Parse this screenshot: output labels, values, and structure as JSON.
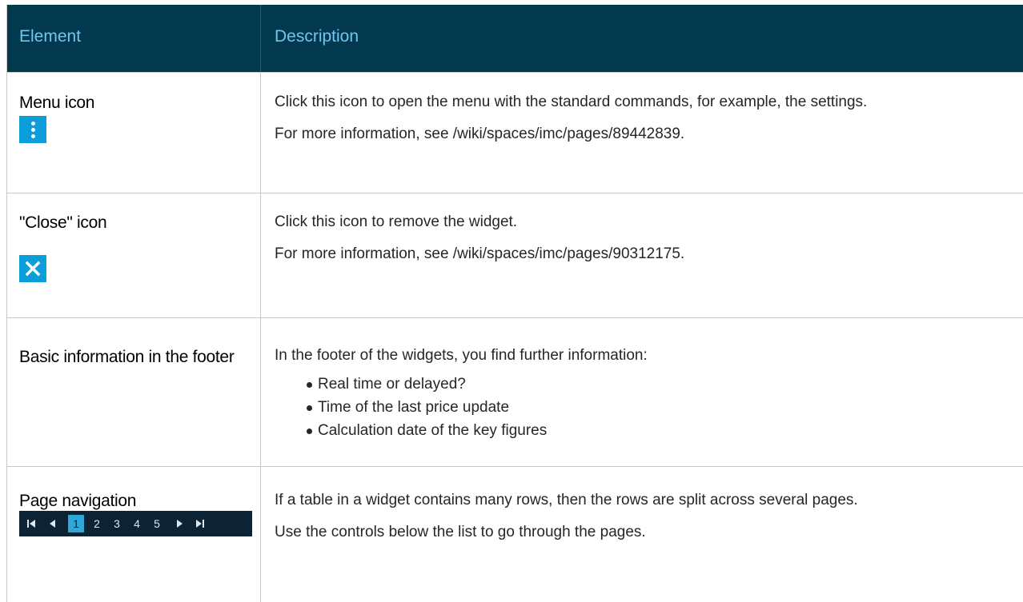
{
  "table": {
    "headers": {
      "element": "Element",
      "description": "Description"
    },
    "rows": [
      {
        "element": "Menu icon",
        "icon": "vertical-dots-menu-icon",
        "paragraphs": [
          "Click this icon to open the menu with the standard commands, for example, the settings.",
          "For more information, see /wiki/spaces/imc/pages/89442839."
        ]
      },
      {
        "element": "\"Close\" icon",
        "icon": "close-icon",
        "paragraphs": [
          "Click this icon to remove the widget.",
          "For more information, see /wiki/spaces/imc/pages/90312175."
        ]
      },
      {
        "element": "Basic information in the footer",
        "intro": "In the footer of the widgets, you find further information:",
        "bullets": [
          "Real time or delayed?",
          "Time of the last price update",
          "Calculation date of the key figures"
        ]
      },
      {
        "element": "Page navigation",
        "pagination": {
          "pages": [
            "1",
            "2",
            "3",
            "4",
            "5"
          ],
          "current": "1"
        },
        "paragraphs": [
          "If a table in a widget contains many rows, then the rows are split across several pages.",
          "Use the controls below the list to go through the pages."
        ]
      }
    ]
  },
  "colors": {
    "header_bg": "#02394f",
    "header_text": "#6fc6ee",
    "icon_blue": "#0c9ed8",
    "pager_bg": "#0d2233"
  }
}
